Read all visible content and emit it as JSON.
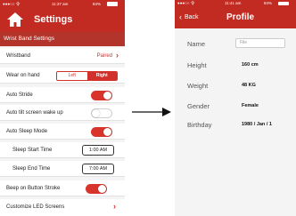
{
  "settings": {
    "status": {
      "carrier": "●●●○○ 令",
      "time": "11:37 am",
      "battery": "84%"
    },
    "title": "Settings",
    "section": "Wrist Band Settings",
    "wristband": {
      "label": "Wristband",
      "value": "Paired"
    },
    "wear_on_hand": {
      "label": "Wear on hand",
      "left": "Left",
      "right": "Right",
      "selected": "Right"
    },
    "auto_stride": {
      "label": "Auto Stride",
      "on": true
    },
    "auto_tilt": {
      "label": "Auto tilt screen wake up",
      "on": false
    },
    "auto_sleep": {
      "label": "Auto Sleep Mode",
      "on": true
    },
    "sleep_start": {
      "label": "Sleep Start Time",
      "value": "1:00 AM"
    },
    "sleep_end": {
      "label": "Sleep End Time",
      "value": "7:00 AM"
    },
    "beep": {
      "label": "Beep on Button Stroke",
      "on": true
    },
    "led": {
      "label": "Customize LED Screens"
    },
    "colors": {
      "accent": "#c22b22"
    }
  },
  "profile": {
    "status": {
      "carrier": "●●●○○ 令",
      "time": "11:41 am",
      "battery": "84%"
    },
    "back_label": "Back",
    "title": "Profile",
    "fields": [
      {
        "label": "Name",
        "value": "",
        "placeholder": "File"
      },
      {
        "label": "Height",
        "value": "160 cm"
      },
      {
        "label": "Weight",
        "value": "48 KG"
      },
      {
        "label": "Gender",
        "value": "Female"
      },
      {
        "label": "Birthday",
        "value": "1980 / Jan / 1"
      }
    ]
  }
}
